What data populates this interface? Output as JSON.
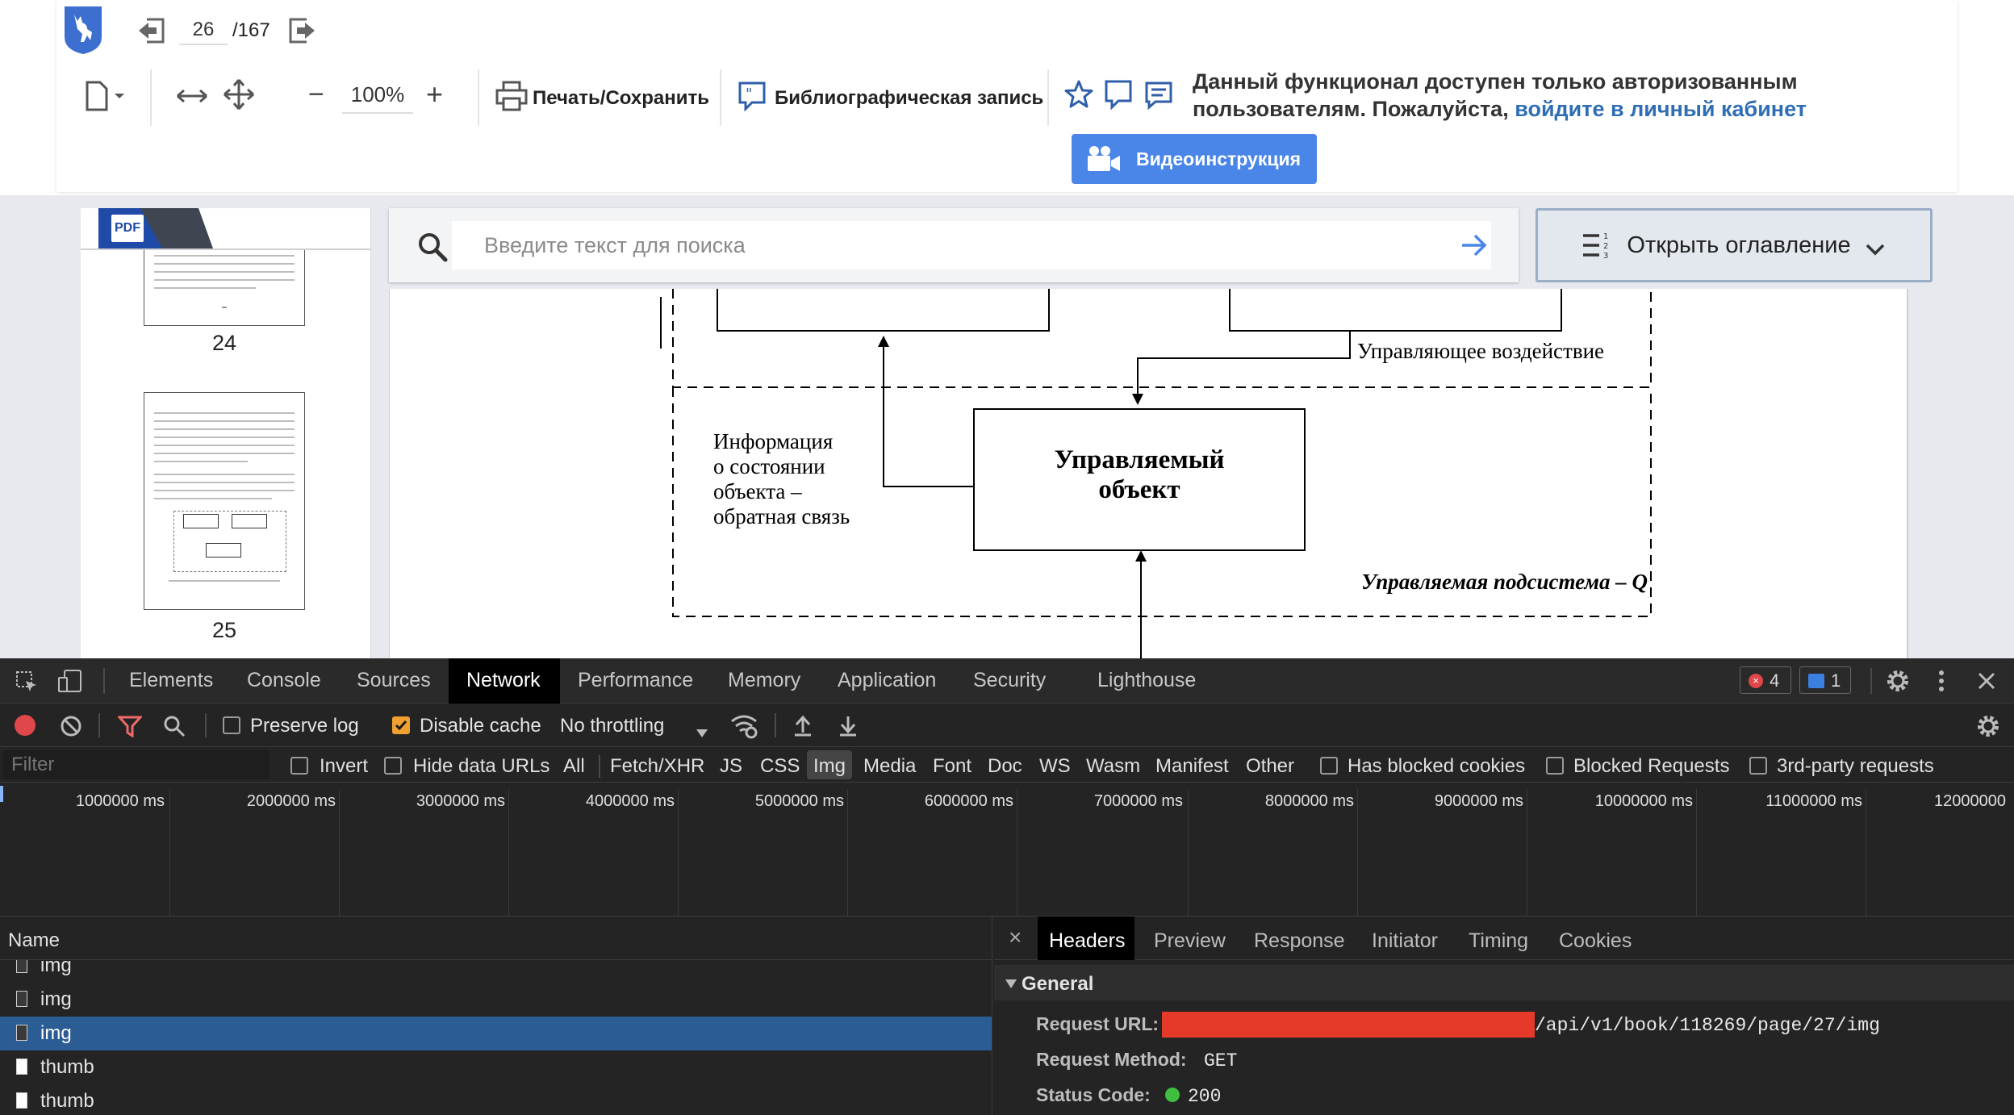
{
  "toolbar": {
    "current_page": "26",
    "total_pages": "/167",
    "zoom": "100%",
    "zoom_minus": "−",
    "zoom_plus": "+",
    "print_label": "Печать/Сохранить",
    "biblio_label": "Библиографическая запись",
    "notice_line1": "Данный функционал доступен только авторизованным",
    "notice_line2_prefix": "пользователям. Пожалуйста, ",
    "notice_link": "войдите в личный кабинет",
    "video_label": "Видеоинструкция"
  },
  "sidebar": {
    "pdf_badge": "PDF",
    "thumbs": [
      {
        "number": "24"
      },
      {
        "number": "25"
      }
    ]
  },
  "search": {
    "placeholder": "Введите текст для поиска"
  },
  "toc": {
    "label": "Открыть оглавление"
  },
  "diagram": {
    "control_action": "Управляющее воздействие",
    "info_line1": "Информация",
    "info_line2": "о состоянии",
    "info_line3": "объекта –",
    "info_line4": "обратная связь",
    "object_line1": "Управляемый",
    "object_line2": "объект",
    "subsystem": "Управляемая подсистема – Q"
  },
  "devtools": {
    "tabs": [
      "Elements",
      "Console",
      "Sources",
      "Network",
      "Performance",
      "Memory",
      "Application",
      "Security",
      "Lighthouse"
    ],
    "active_tab": "Network",
    "errors_count": "4",
    "messages_count": "1",
    "preserve_log": "Preserve log",
    "disable_cache": "Disable cache",
    "throttling": "No throttling",
    "filter_placeholder": "Filter",
    "invert": "Invert",
    "hide_data_urls": "Hide data URLs",
    "filter_types": [
      "All",
      "Fetch/XHR",
      "JS",
      "CSS",
      "Img",
      "Media",
      "Font",
      "Doc",
      "WS",
      "Wasm",
      "Manifest",
      "Other"
    ],
    "active_filter": "Img",
    "has_blocked_cookies": "Has blocked cookies",
    "blocked_requests": "Blocked Requests",
    "third_party": "3rd-party requests",
    "timeline_ticks": [
      "1000000 ms",
      "2000000 ms",
      "3000000 ms",
      "4000000 ms",
      "5000000 ms",
      "6000000 ms",
      "7000000 ms",
      "8000000 ms",
      "9000000 ms",
      "10000000 ms",
      "11000000 ms",
      "12000000"
    ],
    "name_header": "Name",
    "rows": [
      "img",
      "img",
      "img",
      "thumb",
      "thumb"
    ],
    "selected_row_index": 2,
    "detail_tabs": [
      "Headers",
      "Preview",
      "Response",
      "Initiator",
      "Timing",
      "Cookies"
    ],
    "active_detail_tab": "Headers",
    "close_glyph": "×",
    "general_label": "General",
    "request_url_label": "Request URL:",
    "request_url_value": "/api/v1/book/118269/page/27/img",
    "request_method_label": "Request Method:",
    "request_method_value": "GET",
    "status_code_label": "Status Code:",
    "status_code_value": "200"
  },
  "colors": {
    "accent_blue": "#4a86e8",
    "link_blue": "#2f6eb5",
    "devtools_bg": "#242424",
    "selected_row": "#2b5c93",
    "redaction": "#e53a2a",
    "status_ok": "#3fbf3f"
  },
  "icons": [
    "deer-logo-icon",
    "prev-page-icon",
    "next-page-icon",
    "document-menu-icon",
    "fit-width-icon",
    "fullscreen-icon",
    "print-icon",
    "quote-icon",
    "star-icon",
    "comment-icon",
    "video-camera-icon",
    "search-icon",
    "arrow-right-icon",
    "toc-list-icon",
    "chevron-down-icon",
    "gear-icon",
    "kebab-icon"
  ]
}
